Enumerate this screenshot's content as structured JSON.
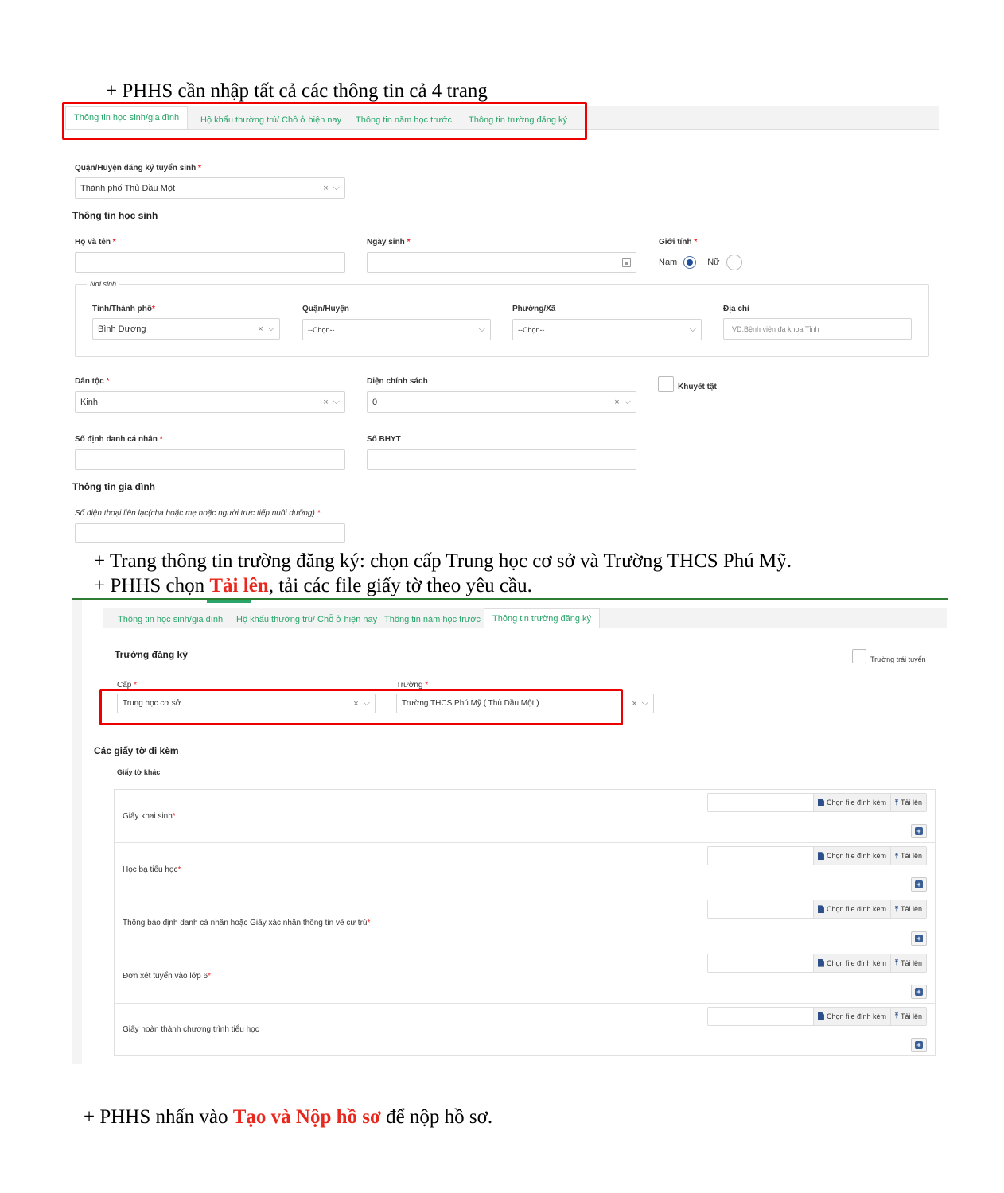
{
  "doc": {
    "line1": "+ PHHS cần nhập tất cả các thông tin cả 4 trang",
    "line2": "+ Trang thông tin trường đăng ký: chọn cấp Trung học cơ sở và Trường THCS Phú Mỹ.",
    "line3_prefix": "+  PHHS chọn ",
    "line3_emph": "Tải lên",
    "line3_suffix": ", tải các file giấy tờ theo yêu cầu.",
    "line4_prefix": "+ PHHS nhấn vào ",
    "line4_emph": "Tạo và Nộp hồ sơ",
    "line4_suffix": " để nộp hồ sơ."
  },
  "tabs": [
    "Thông tin học sinh/gia đình",
    "Hộ khẩu thường trú/ Chỗ ở hiện nay",
    "Thông tin năm học trước",
    "Thông tin trường đăng ký"
  ],
  "form1": {
    "district_label": "Quận/Huyện đăng ký tuyển sinh",
    "district_value": "Thành phố Thủ Dầu Một",
    "student_section": "Thông tin học sinh",
    "name_label": "Họ và tên",
    "name_value": "",
    "dob_label": "Ngày sinh",
    "dob_value": "",
    "gender_label": "Giới tính",
    "gender_male": "Nam",
    "gender_female": "Nữ",
    "gender_selected": "Nam",
    "birthplace_legend": "Nơi sinh",
    "province_label": "Tỉnh/Thành phố",
    "province_value": "Bình Dương",
    "bp_district_label": "Quận/Huyện",
    "bp_district_value": "--Chọn--",
    "ward_label": "Phường/Xã",
    "ward_value": "--Chọn--",
    "address_label": "Địa chỉ",
    "address_placeholder": "VD:Bệnh viện đa khoa Tỉnh",
    "ethnic_label": "Dân tộc",
    "ethnic_value": "Kinh",
    "policy_label": "Diện chính sách",
    "policy_value": "0",
    "disabled_label": "Khuyết tật",
    "id_label": "Số định danh cá nhân",
    "id_value": "",
    "insurance_label": "Số BHYT",
    "insurance_value": "",
    "family_section": "Thông tin gia đình",
    "phone_label": "Số điện thoại liên lạc(cha hoặc mẹ hoặc người trực tiếp nuôi dưỡng)",
    "phone_value": ""
  },
  "form2": {
    "school_section": "Trường đăng ký",
    "off_route_label": "Trường trái tuyến",
    "level_label": "Cấp",
    "level_value": "Trung học cơ sở",
    "school_label": "Trường",
    "school_value": "Trường THCS Phú Mỹ ( Thủ Dầu Một )",
    "attachments_section": "Các giấy tờ đi kèm",
    "other_docs_label": "Giấy tờ khác",
    "choose_label": "Chọn file đính kèm",
    "upload_label": "Tải lên",
    "documents": [
      {
        "name": "Giấy khai sinh",
        "required": true
      },
      {
        "name": "Học bạ tiểu học",
        "required": true
      },
      {
        "name": "Thông báo định danh cá nhân hoặc Giấy xác nhận thông tin về cư trú",
        "required": true
      },
      {
        "name": "Đơn xét tuyển vào lớp 6",
        "required": true
      },
      {
        "name": "Giấy hoàn thành chương trình tiểu học",
        "required": false
      }
    ]
  }
}
